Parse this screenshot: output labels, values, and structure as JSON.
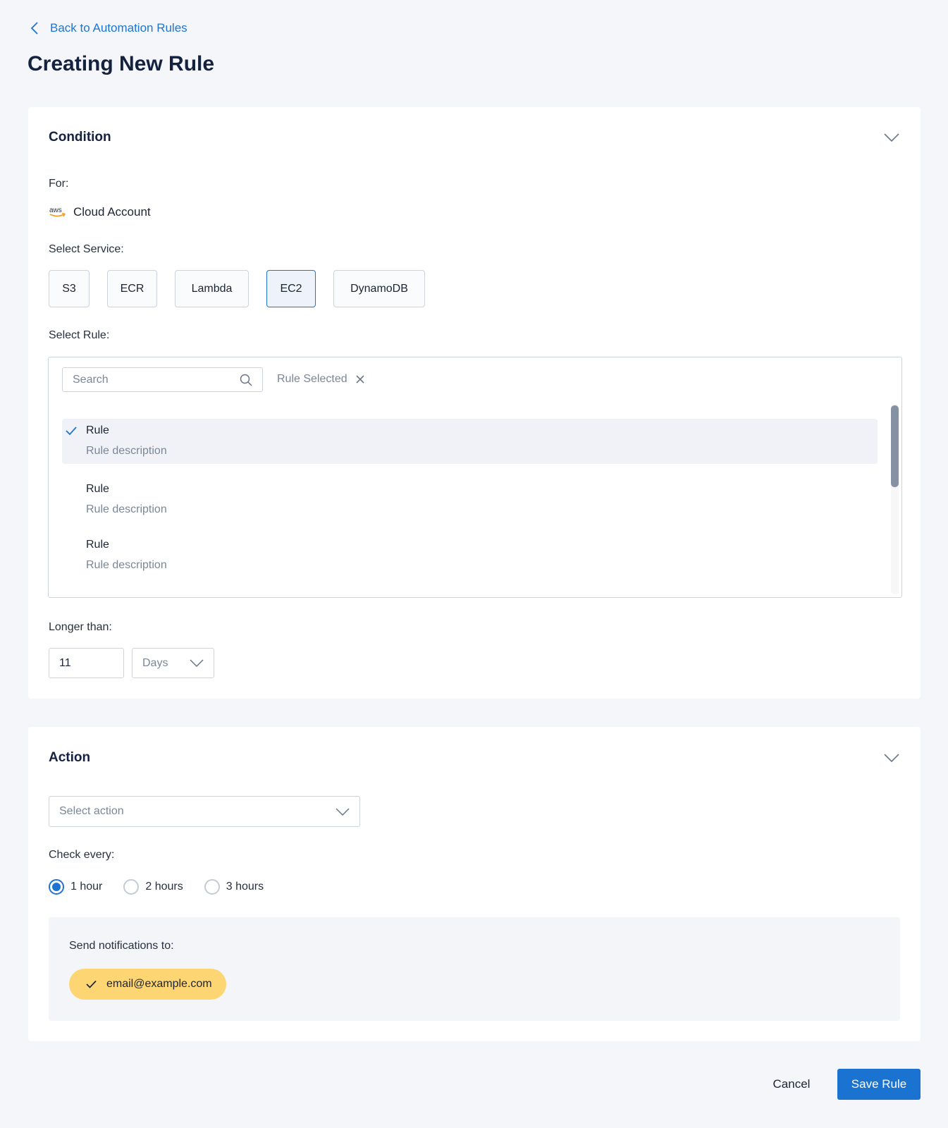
{
  "nav": {
    "back_label": "Back to Automation Rules"
  },
  "page": {
    "title": "Creating New Rule"
  },
  "condition": {
    "title": "Condition",
    "for_label": "For:",
    "account_icon": "aws-logo-icon",
    "account_name": "Cloud Account",
    "service_label": "Select Service:",
    "services": [
      {
        "label": "S3",
        "selected": false
      },
      {
        "label": "ECR",
        "selected": false
      },
      {
        "label": "Lambda",
        "selected": false
      },
      {
        "label": "EC2",
        "selected": true
      },
      {
        "label": "DynamoDB",
        "selected": false
      }
    ],
    "rule_label": "Select Rule:",
    "search_placeholder": "Search",
    "rule_selected_chip": "Rule Selected",
    "rules": [
      {
        "name": "Rule",
        "description": "Rule description",
        "selected": true
      },
      {
        "name": "Rule",
        "description": "Rule description",
        "selected": false
      },
      {
        "name": "Rule",
        "description": "Rule description",
        "selected": false
      }
    ],
    "longer_than_label": "Longer than:",
    "longer_than_value": "11",
    "unit_selected": "Days"
  },
  "action": {
    "title": "Action",
    "select_placeholder": "Select action",
    "check_every_label": "Check every:",
    "intervals": [
      {
        "label": "1 hour",
        "selected": true
      },
      {
        "label": "2 hours",
        "selected": false
      },
      {
        "label": "3 hours",
        "selected": false
      }
    ],
    "notify_label": "Send notifications to:",
    "notify_email": "email@example.com"
  },
  "footer": {
    "cancel_label": "Cancel",
    "save_label": "Save Rule"
  },
  "colors": {
    "accent": "#1a73d1",
    "chip": "#fdd673",
    "background": "#f5f6fa",
    "title": "#14223f"
  }
}
